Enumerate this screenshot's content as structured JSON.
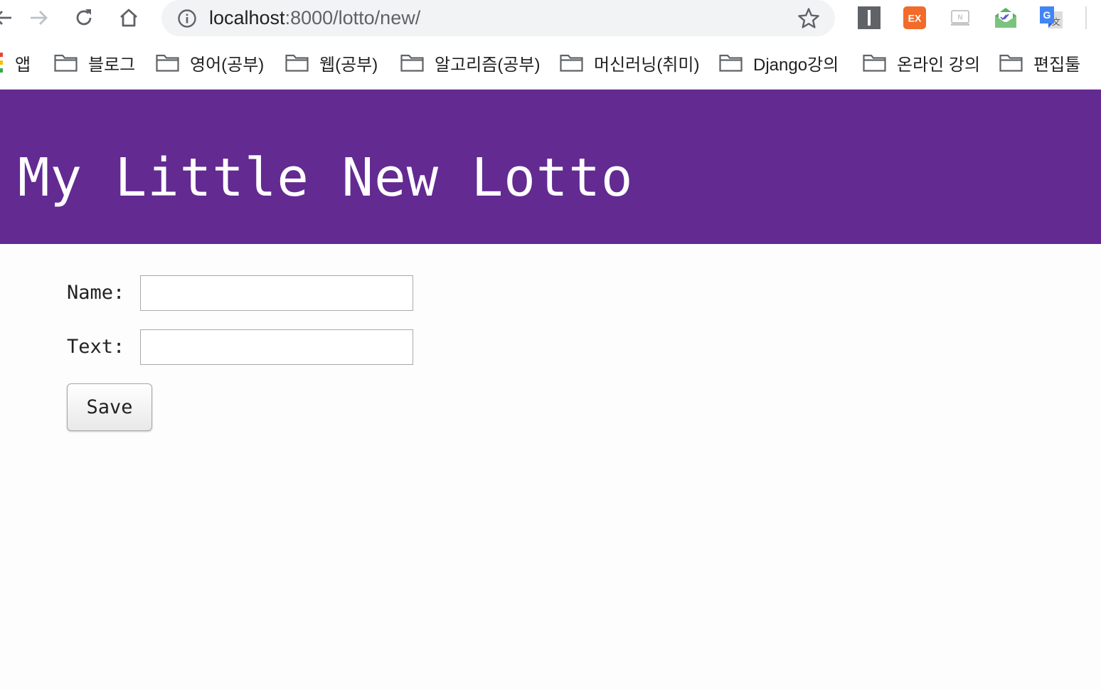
{
  "browser": {
    "url": {
      "host": "localhost",
      "path": ":8000/lotto/new/"
    },
    "bookmarks": [
      {
        "label": "앱",
        "icon": "apps-icon"
      },
      {
        "label": "블로그",
        "icon": "folder-icon"
      },
      {
        "label": "영어(공부)",
        "icon": "folder-icon"
      },
      {
        "label": "웹(공부)",
        "icon": "folder-icon"
      },
      {
        "label": "알고리즘(공부)",
        "icon": "folder-icon"
      },
      {
        "label": "머신러닝(취미)",
        "icon": "folder-icon"
      },
      {
        "label": "Django강의",
        "icon": "folder-icon"
      },
      {
        "label": "온라인 강의",
        "icon": "folder-icon"
      },
      {
        "label": "편집툴",
        "icon": "folder-icon"
      }
    ],
    "extensions": [
      {
        "name": "instapaper-extension-icon",
        "text": "I",
        "color": "#5f6368"
      },
      {
        "name": "ex-extension-icon",
        "text": "EX",
        "color": "#f26b2a"
      },
      {
        "name": "n-extension-icon",
        "text": "N",
        "color": "#c7c7c7"
      },
      {
        "name": "mail-check-extension-icon",
        "text": "",
        "color": "#4caf50"
      },
      {
        "name": "google-translate-extension-icon",
        "text": "G",
        "color": "#4285f4"
      }
    ]
  },
  "page": {
    "title": "My Little New Lotto",
    "header_color": "#632a92",
    "form": {
      "name_label": "Name:",
      "name_value": "",
      "text_label": "Text:",
      "text_value": "",
      "save_label": "Save"
    }
  }
}
